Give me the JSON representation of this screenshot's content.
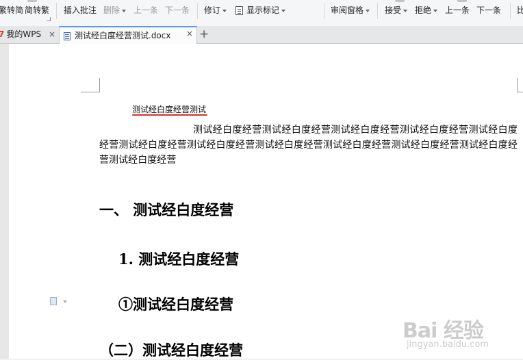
{
  "toolbar": {
    "items": {
      "trad_to_simp": "繁转简",
      "simp_to_trad": "简转繁",
      "insert_comment": "插入批注",
      "delete": "删除",
      "prev_comment": "上一条",
      "next_comment": "下一条",
      "track_changes": "修订",
      "show_markup": "显示标记",
      "review_pane": "审阅窗格",
      "accept": "接受",
      "reject": "拒绝",
      "prev_change": "上一条",
      "next_change": "下一条",
      "compare": "比"
    }
  },
  "tabs": {
    "home": {
      "num": "7",
      "label": "我的WPS"
    },
    "document": {
      "label": "测试经白度经营测试.docx"
    },
    "close_symbol": "×",
    "add_symbol": "+"
  },
  "document": {
    "header_text": "测试经白度经营测试",
    "body_text": "测试经白度经营测试经白度经营测试经白度经营测试经白度经营测试经白度经营测试经白度经营测试经白度经营测试经白度经营测试经白度经营测试经白度经营测试经白度经营测试经白度经营",
    "headings": {
      "h1": "一、 测试经白度经营",
      "h2": "1. 测试经白度经营",
      "h3": "①测试经白度经营",
      "h4": "（二）测试经白度经营"
    }
  },
  "watermark": {
    "logo": "Bai 经验",
    "url": "jingyan.baidu.com"
  },
  "colors": {
    "tab_accent": "#5a9ae8",
    "spellcheck_underline": "#d9312b",
    "wps_brand": "#e8322b"
  }
}
